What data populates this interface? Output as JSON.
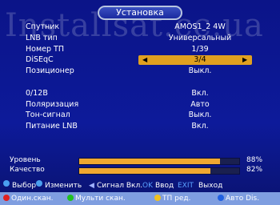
{
  "watermark": "Installsat.cc.ua",
  "title": "Установка",
  "rows": [
    {
      "label": "Спутник",
      "value": "AMOS1_2  4W"
    },
    {
      "label": "LNB  тип",
      "value": "Универсальный"
    },
    {
      "label": "Номер  ТП",
      "value": "1/39"
    },
    {
      "label": "DiSEqC",
      "value": "3/4"
    },
    {
      "label": "Позиционер",
      "value": "Выкл."
    },
    {
      "label": "",
      "value": ""
    },
    {
      "label": "0/12В",
      "value": "Вкл."
    },
    {
      "label": "Поляризация",
      "value": "Авто"
    },
    {
      "label": "Тон-сигнал",
      "value": "Выкл."
    },
    {
      "label": "Питание  LNB",
      "value": "Вкл."
    }
  ],
  "meters": {
    "level": {
      "label": "Уровень",
      "pct_text": "88%",
      "value": 88
    },
    "quality": {
      "label": "Качество",
      "pct_text": "82%",
      "value": 82
    }
  },
  "help": {
    "select": "Выбор",
    "change": "Изменить",
    "signal": "Сигнал  Вкл.",
    "ok_key": "OK",
    "enter": "Ввод",
    "exit_key": "EXIT",
    "exit": "Выход"
  },
  "colorbar": {
    "red": "Один.скан.",
    "green": "Мульти  скан.",
    "yellow": "ТП  ред.",
    "blue": "Авто  Dis."
  },
  "colors": {
    "selected_bar": "#e0a020",
    "meter_fill": "#f0a830",
    "red": "#e02020",
    "green": "#20c020",
    "yellow": "#f0c020",
    "blue": "#2060e0"
  }
}
